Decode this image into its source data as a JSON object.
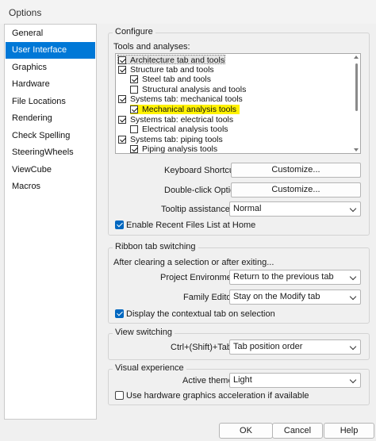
{
  "window": {
    "title": "Options"
  },
  "sidebar": {
    "items": [
      {
        "label": "General"
      },
      {
        "label": "User Interface"
      },
      {
        "label": "Graphics"
      },
      {
        "label": "Hardware"
      },
      {
        "label": "File Locations"
      },
      {
        "label": "Rendering"
      },
      {
        "label": "Check Spelling"
      },
      {
        "label": "SteeringWheels"
      },
      {
        "label": "ViewCube"
      },
      {
        "label": "Macros"
      }
    ],
    "selected": "User Interface"
  },
  "configure": {
    "title": "Configure",
    "tools_label": "Tools and analyses:",
    "tree": [
      {
        "label": "Architecture tab and tools",
        "checked": true
      },
      {
        "label": "Structure tab and tools",
        "checked": true
      },
      {
        "label": "Steel tab and tools",
        "checked": true
      },
      {
        "label": "Structural analysis and tools",
        "checked": false
      },
      {
        "label": "Systems tab: mechanical tools",
        "checked": true
      },
      {
        "label": "Mechanical analysis tools",
        "checked": true,
        "highlight": "#fff200"
      },
      {
        "label": "Systems tab: electrical tools",
        "checked": true
      },
      {
        "label": "Electrical analysis tools",
        "checked": false
      },
      {
        "label": "Systems tab: piping tools",
        "checked": true
      },
      {
        "label": "Piping analysis tools",
        "checked": true
      }
    ],
    "keyboard_shortcuts": {
      "label": "Keyboard Shortcuts:",
      "button": "Customize..."
    },
    "double_click": {
      "label": "Double-click Options:",
      "button": "Customize..."
    },
    "tooltip": {
      "label": "Tooltip assistance:",
      "value": "Normal"
    },
    "recent_files": {
      "label": "Enable Recent Files List at Home",
      "checked": true
    }
  },
  "ribbon": {
    "title": "Ribbon tab switching",
    "subtitle": "After clearing a selection or after exiting...",
    "project_env": {
      "label": "Project Environment:",
      "value": "Return to the previous tab"
    },
    "family_editor": {
      "label": "Family Editor:",
      "value": "Stay on the Modify tab"
    },
    "contextual": {
      "label": "Display the contextual tab on selection",
      "checked": true
    }
  },
  "view_switching": {
    "title": "View switching",
    "shortcut": {
      "label": "Ctrl+(Shift)+Tab:",
      "value": "Tab position order"
    }
  },
  "visual": {
    "title": "Visual experience",
    "theme": {
      "label": "Active theme:",
      "value": "Light"
    },
    "hw_accel": {
      "label": "Use hardware graphics acceleration if available",
      "checked": false
    }
  },
  "footer": {
    "ok": "OK",
    "cancel": "Cancel",
    "help": "Help"
  },
  "colors": {
    "accent": "#0078d7",
    "checkbox_on": "#0067c0",
    "highlight": "#fff200"
  }
}
